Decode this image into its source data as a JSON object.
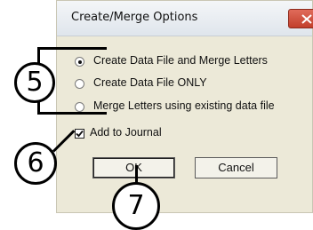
{
  "window": {
    "title": "Create/Merge Options"
  },
  "options": [
    {
      "label": "Create Data File and Merge Letters",
      "selected": true
    },
    {
      "label": "Create Data File ONLY",
      "selected": false
    },
    {
      "label": "Merge Letters using existing data file",
      "selected": false
    }
  ],
  "journal": {
    "label": "Add to Journal",
    "checked": true
  },
  "buttons": {
    "ok": "OK",
    "cancel": "Cancel"
  },
  "callouts": {
    "c5": "5",
    "c6": "6",
    "c7": "7"
  },
  "colors": {
    "dialog_bg": "#ece9d8",
    "close_button": "#c94a36"
  }
}
